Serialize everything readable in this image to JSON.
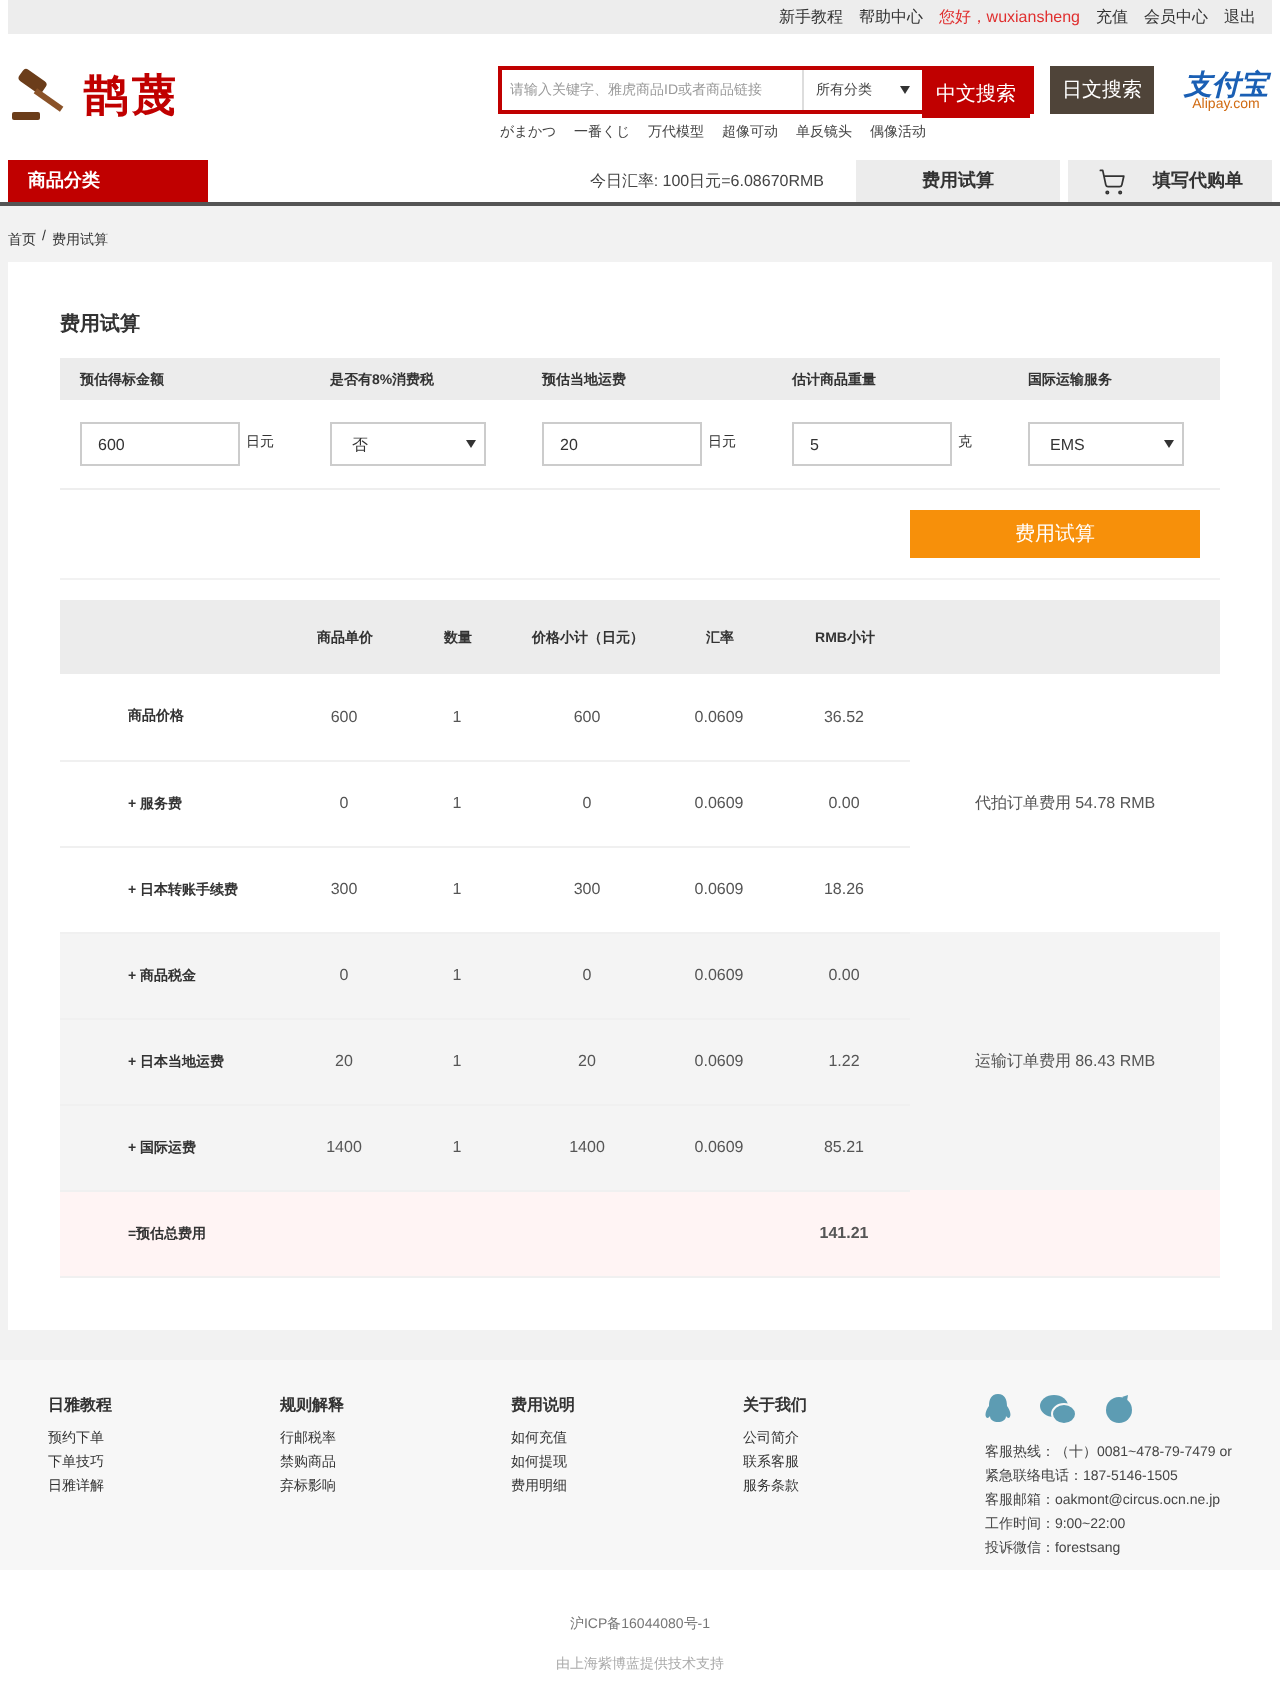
{
  "top_bar": {
    "links": [
      "新手教程",
      "帮助中心"
    ],
    "greeting": "您好，wuxiansheng",
    "account_links": [
      "充值",
      "会员中心",
      "退出"
    ]
  },
  "logo": {
    "text": "鹊蔑"
  },
  "search": {
    "placeholder": "请输入关键字、雅虎商品ID或者商品链接",
    "category": "所有分类",
    "buttons": [
      "中文搜索",
      "日文搜索"
    ]
  },
  "alipay": {
    "name": "支付宝",
    "domain": "Alipay.com"
  },
  "hot_tags": [
    "がまかつ",
    "一番くじ",
    "万代模型",
    "超像可动",
    "单反镜头",
    "偶像活动"
  ],
  "nav": {
    "category": "商品分类",
    "exchange_rate": "今日汇率: 100日元=6.08670RMB",
    "tabs": [
      {
        "label": "费用试算",
        "icon": false
      },
      {
        "label": "填写代购单",
        "icon": true
      }
    ]
  },
  "breadcrumb": {
    "items": [
      "首页",
      "费用试算"
    ],
    "separator": "/"
  },
  "calculator": {
    "title": "费用试算",
    "fields": [
      {
        "label": "预估得标金额",
        "kind": "input",
        "value": "600",
        "unit": "日元"
      },
      {
        "label": "是否有8%消费税",
        "kind": "select",
        "value": "否"
      },
      {
        "label": "预估当地运费",
        "kind": "input",
        "value": "20",
        "unit": "日元"
      },
      {
        "label": "估计商品重量",
        "kind": "input",
        "value": "5",
        "unit": "克"
      },
      {
        "label": "国际运输服务",
        "kind": "select",
        "value": "EMS"
      }
    ],
    "button": "费用试算"
  },
  "table": {
    "columns": [
      "商品单价",
      "数量",
      "价格小计（日元）",
      "汇率",
      "RMB小计"
    ],
    "groups": [
      {
        "note": "代拍订单费用 54.78 RMB",
        "rows": [
          {
            "label": "商品价格",
            "cells": [
              "600",
              "1",
              "600",
              "0.0609",
              "36.52"
            ]
          },
          {
            "label": "+ 服务费",
            "cells": [
              "0",
              "1",
              "0",
              "0.0609",
              "0.00"
            ]
          },
          {
            "label": "+ 日本转账手续费",
            "cells": [
              "300",
              "1",
              "300",
              "0.0609",
              "18.26"
            ]
          }
        ]
      },
      {
        "note": "运输订单费用 86.43 RMB",
        "rows": [
          {
            "label": "+ 商品税金",
            "cells": [
              "0",
              "1",
              "0",
              "0.0609",
              "0.00"
            ]
          },
          {
            "label": "+ 日本当地运费",
            "cells": [
              "20",
              "1",
              "20",
              "0.0609",
              "1.22"
            ]
          },
          {
            "label": "+ 国际运费",
            "cells": [
              "1400",
              "1",
              "1400",
              "0.0609",
              "85.21"
            ]
          }
        ]
      }
    ],
    "total": {
      "label": "=预估总费用",
      "value": "141.21"
    }
  },
  "footer": {
    "columns": [
      {
        "title": "日雅教程",
        "links": [
          "预约下单",
          "下单技巧",
          "日雅详解"
        ]
      },
      {
        "title": "规则解释",
        "links": [
          "行邮税率",
          "禁购商品",
          "弃标影响"
        ]
      },
      {
        "title": "费用说明",
        "links": [
          "如何充值",
          "如何提现",
          "费用明细"
        ]
      },
      {
        "title": "关于我们",
        "links": [
          "公司简介",
          "联系客服",
          "服务条款"
        ]
      }
    ],
    "contact": [
      "客服热线：（十）0081~478-79-7479 or",
      "紧急联络电话：187-5146-1505",
      "客服邮箱：oakmont@circus.ocn.ne.jp",
      "工作时间：9:00~22:00",
      "投诉微信：forestsang"
    ],
    "icp": "沪ICP备16044080号-1",
    "support": "由上海紫博蓝提供技术支持"
  }
}
